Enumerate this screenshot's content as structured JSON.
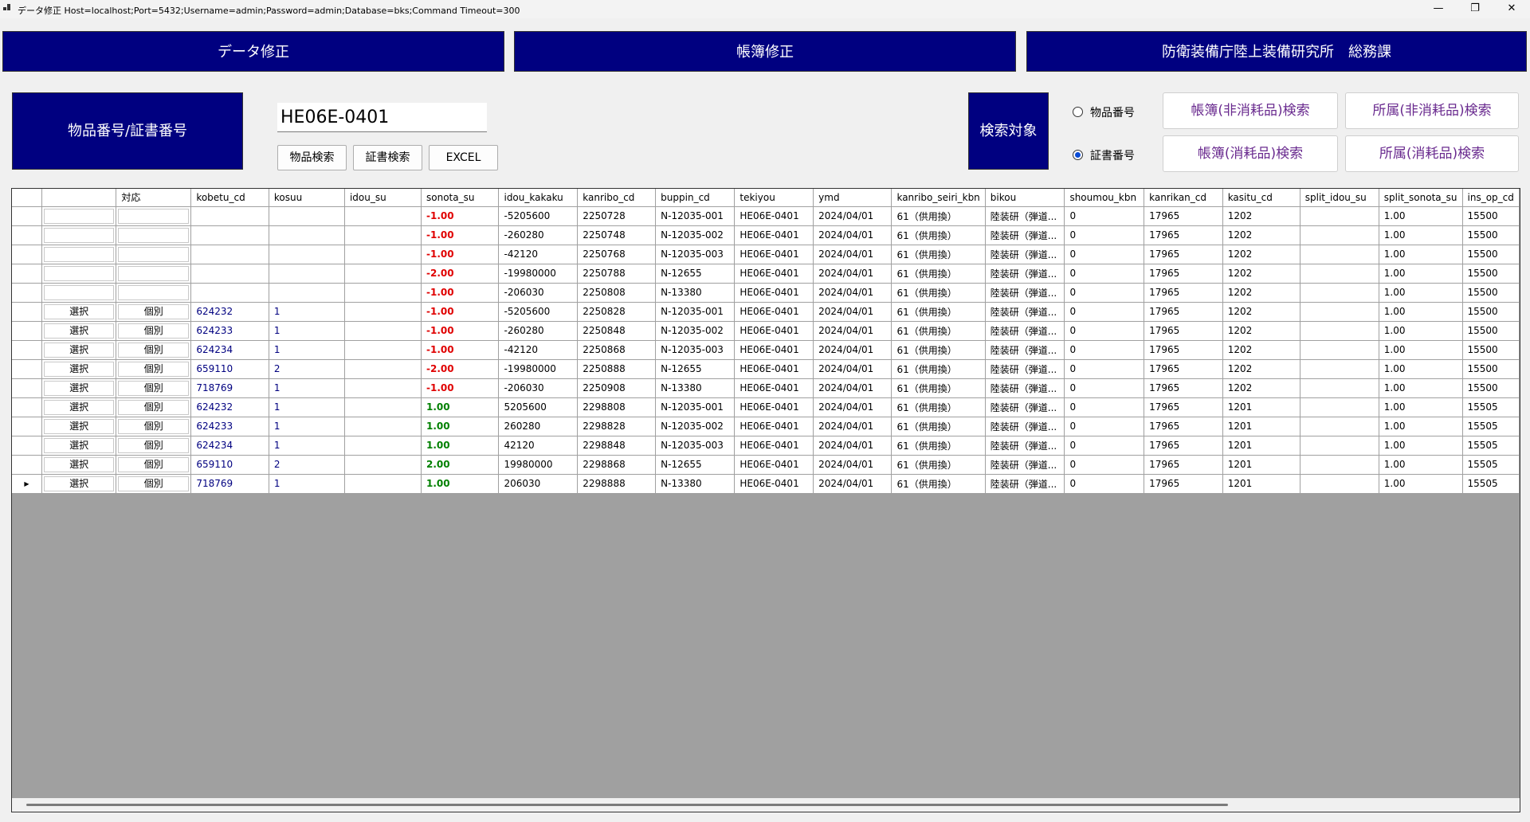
{
  "window": {
    "title": "データ修正 Host=localhost;Port=5432;Username=admin;Password=admin;Database=bks;Command Timeout=300",
    "minimize": "—",
    "restore": "❐",
    "close": "✕"
  },
  "nav": {
    "data_fix": "データ修正",
    "ledger_fix": "帳簿修正",
    "org": "防衛装備庁陸上装備研究所　総務課"
  },
  "search": {
    "label": "物品番号/証書番号",
    "value": "HE06E-0401",
    "item_search": "物品検索",
    "cert_search": "証書検索",
    "excel": "EXCEL",
    "target_label": "検索対象",
    "radio_item": "物品番号",
    "radio_cert": "証書番号",
    "selected_radio": "証書番号",
    "btn_ledger_nonconsumable": "帳簿(非消耗品)検索",
    "btn_dept_nonconsumable": "所属(非消耗品)検索",
    "btn_ledger_consumable": "帳簿(消耗品)検索",
    "btn_dept_consumable": "所属(消耗品)検索"
  },
  "grid": {
    "columns": [
      "",
      "",
      "対応",
      "kobetu_cd",
      "kosuu",
      "idou_su",
      "sonota_su",
      "idou_kakaku",
      "kanribo_cd",
      "buppin_cd",
      "tekiyou",
      "ymd",
      "kanribo_seiri_kbn",
      "bikou",
      "shoumou_kbn",
      "kanrikan_cd",
      "kasitu_cd",
      "split_idou_su",
      "split_sonota_su",
      "ins_op_cd"
    ],
    "current_row_marker": "▶",
    "rows": [
      {
        "sel": "",
        "taiou": "",
        "kobetu_cd": "",
        "kosuu": "",
        "idou_su": "",
        "sonota_su": "-1.00",
        "idou_kakaku": "-5205600",
        "kanribo_cd": "2250728",
        "buppin_cd": "N-12035-001",
        "tekiyou": "HE06E-0401",
        "ymd": "2024/04/01",
        "kanribo_seiri_kbn": "61（供用換）",
        "bikou": "陸装研（弾道...",
        "shoumou_kbn": "0",
        "kanrikan_cd": "17965",
        "kasitu_cd": "1202",
        "split_idou_su": "",
        "split_sonota_su": "1.00",
        "ins_op_cd": "15500"
      },
      {
        "sel": "",
        "taiou": "",
        "kobetu_cd": "",
        "kosuu": "",
        "idou_su": "",
        "sonota_su": "-1.00",
        "idou_kakaku": "-260280",
        "kanribo_cd": "2250748",
        "buppin_cd": "N-12035-002",
        "tekiyou": "HE06E-0401",
        "ymd": "2024/04/01",
        "kanribo_seiri_kbn": "61（供用換）",
        "bikou": "陸装研（弾道...",
        "shoumou_kbn": "0",
        "kanrikan_cd": "17965",
        "kasitu_cd": "1202",
        "split_idou_su": "",
        "split_sonota_su": "1.00",
        "ins_op_cd": "15500"
      },
      {
        "sel": "",
        "taiou": "",
        "kobetu_cd": "",
        "kosuu": "",
        "idou_su": "",
        "sonota_su": "-1.00",
        "idou_kakaku": "-42120",
        "kanribo_cd": "2250768",
        "buppin_cd": "N-12035-003",
        "tekiyou": "HE06E-0401",
        "ymd": "2024/04/01",
        "kanribo_seiri_kbn": "61（供用換）",
        "bikou": "陸装研（弾道...",
        "shoumou_kbn": "0",
        "kanrikan_cd": "17965",
        "kasitu_cd": "1202",
        "split_idou_su": "",
        "split_sonota_su": "1.00",
        "ins_op_cd": "15500"
      },
      {
        "sel": "",
        "taiou": "",
        "kobetu_cd": "",
        "kosuu": "",
        "idou_su": "",
        "sonota_su": "-2.00",
        "idou_kakaku": "-19980000",
        "kanribo_cd": "2250788",
        "buppin_cd": "N-12655",
        "tekiyou": "HE06E-0401",
        "ymd": "2024/04/01",
        "kanribo_seiri_kbn": "61（供用換）",
        "bikou": "陸装研（弾道...",
        "shoumou_kbn": "0",
        "kanrikan_cd": "17965",
        "kasitu_cd": "1202",
        "split_idou_su": "",
        "split_sonota_su": "1.00",
        "ins_op_cd": "15500"
      },
      {
        "sel": "",
        "taiou": "",
        "kobetu_cd": "",
        "kosuu": "",
        "idou_su": "",
        "sonota_su": "-1.00",
        "idou_kakaku": "-206030",
        "kanribo_cd": "2250808",
        "buppin_cd": "N-13380",
        "tekiyou": "HE06E-0401",
        "ymd": "2024/04/01",
        "kanribo_seiri_kbn": "61（供用換）",
        "bikou": "陸装研（弾道...",
        "shoumou_kbn": "0",
        "kanrikan_cd": "17965",
        "kasitu_cd": "1202",
        "split_idou_su": "",
        "split_sonota_su": "1.00",
        "ins_op_cd": "15500"
      },
      {
        "sel": "選択",
        "taiou": "個別",
        "kobetu_cd": "624232",
        "kosuu": "1",
        "idou_su": "",
        "sonota_su": "-1.00",
        "idou_kakaku": "-5205600",
        "kanribo_cd": "2250828",
        "buppin_cd": "N-12035-001",
        "tekiyou": "HE06E-0401",
        "ymd": "2024/04/01",
        "kanribo_seiri_kbn": "61（供用換）",
        "bikou": "陸装研（弾道...",
        "shoumou_kbn": "0",
        "kanrikan_cd": "17965",
        "kasitu_cd": "1202",
        "split_idou_su": "",
        "split_sonota_su": "1.00",
        "ins_op_cd": "15500"
      },
      {
        "sel": "選択",
        "taiou": "個別",
        "kobetu_cd": "624233",
        "kosuu": "1",
        "idou_su": "",
        "sonota_su": "-1.00",
        "idou_kakaku": "-260280",
        "kanribo_cd": "2250848",
        "buppin_cd": "N-12035-002",
        "tekiyou": "HE06E-0401",
        "ymd": "2024/04/01",
        "kanribo_seiri_kbn": "61（供用換）",
        "bikou": "陸装研（弾道...",
        "shoumou_kbn": "0",
        "kanrikan_cd": "17965",
        "kasitu_cd": "1202",
        "split_idou_su": "",
        "split_sonota_su": "1.00",
        "ins_op_cd": "15500"
      },
      {
        "sel": "選択",
        "taiou": "個別",
        "kobetu_cd": "624234",
        "kosuu": "1",
        "idou_su": "",
        "sonota_su": "-1.00",
        "idou_kakaku": "-42120",
        "kanribo_cd": "2250868",
        "buppin_cd": "N-12035-003",
        "tekiyou": "HE06E-0401",
        "ymd": "2024/04/01",
        "kanribo_seiri_kbn": "61（供用換）",
        "bikou": "陸装研（弾道...",
        "shoumou_kbn": "0",
        "kanrikan_cd": "17965",
        "kasitu_cd": "1202",
        "split_idou_su": "",
        "split_sonota_su": "1.00",
        "ins_op_cd": "15500"
      },
      {
        "sel": "選択",
        "taiou": "個別",
        "kobetu_cd": "659110",
        "kosuu": "2",
        "idou_su": "",
        "sonota_su": "-2.00",
        "idou_kakaku": "-19980000",
        "kanribo_cd": "2250888",
        "buppin_cd": "N-12655",
        "tekiyou": "HE06E-0401",
        "ymd": "2024/04/01",
        "kanribo_seiri_kbn": "61（供用換）",
        "bikou": "陸装研（弾道...",
        "shoumou_kbn": "0",
        "kanrikan_cd": "17965",
        "kasitu_cd": "1202",
        "split_idou_su": "",
        "split_sonota_su": "1.00",
        "ins_op_cd": "15500"
      },
      {
        "sel": "選択",
        "taiou": "個別",
        "kobetu_cd": "718769",
        "kosuu": "1",
        "idou_su": "",
        "sonota_su": "-1.00",
        "idou_kakaku": "-206030",
        "kanribo_cd": "2250908",
        "buppin_cd": "N-13380",
        "tekiyou": "HE06E-0401",
        "ymd": "2024/04/01",
        "kanribo_seiri_kbn": "61（供用換）",
        "bikou": "陸装研（弾道...",
        "shoumou_kbn": "0",
        "kanrikan_cd": "17965",
        "kasitu_cd": "1202",
        "split_idou_su": "",
        "split_sonota_su": "1.00",
        "ins_op_cd": "15500"
      },
      {
        "sel": "選択",
        "taiou": "個別",
        "kobetu_cd": "624232",
        "kosuu": "1",
        "idou_su": "",
        "sonota_su": "1.00",
        "idou_kakaku": "5205600",
        "kanribo_cd": "2298808",
        "buppin_cd": "N-12035-001",
        "tekiyou": "HE06E-0401",
        "ymd": "2024/04/01",
        "kanribo_seiri_kbn": "61（供用換）",
        "bikou": "陸装研（弾道...",
        "shoumou_kbn": "0",
        "kanrikan_cd": "17965",
        "kasitu_cd": "1201",
        "split_idou_su": "",
        "split_sonota_su": "1.00",
        "ins_op_cd": "15505"
      },
      {
        "sel": "選択",
        "taiou": "個別",
        "kobetu_cd": "624233",
        "kosuu": "1",
        "idou_su": "",
        "sonota_su": "1.00",
        "idou_kakaku": "260280",
        "kanribo_cd": "2298828",
        "buppin_cd": "N-12035-002",
        "tekiyou": "HE06E-0401",
        "ymd": "2024/04/01",
        "kanribo_seiri_kbn": "61（供用換）",
        "bikou": "陸装研（弾道...",
        "shoumou_kbn": "0",
        "kanrikan_cd": "17965",
        "kasitu_cd": "1201",
        "split_idou_su": "",
        "split_sonota_su": "1.00",
        "ins_op_cd": "15505"
      },
      {
        "sel": "選択",
        "taiou": "個別",
        "kobetu_cd": "624234",
        "kosuu": "1",
        "idou_su": "",
        "sonota_su": "1.00",
        "idou_kakaku": "42120",
        "kanribo_cd": "2298848",
        "buppin_cd": "N-12035-003",
        "tekiyou": "HE06E-0401",
        "ymd": "2024/04/01",
        "kanribo_seiri_kbn": "61（供用換）",
        "bikou": "陸装研（弾道...",
        "shoumou_kbn": "0",
        "kanrikan_cd": "17965",
        "kasitu_cd": "1201",
        "split_idou_su": "",
        "split_sonota_su": "1.00",
        "ins_op_cd": "15505"
      },
      {
        "sel": "選択",
        "taiou": "個別",
        "kobetu_cd": "659110",
        "kosuu": "2",
        "idou_su": "",
        "sonota_su": "2.00",
        "idou_kakaku": "19980000",
        "kanribo_cd": "2298868",
        "buppin_cd": "N-12655",
        "tekiyou": "HE06E-0401",
        "ymd": "2024/04/01",
        "kanribo_seiri_kbn": "61（供用換）",
        "bikou": "陸装研（弾道...",
        "shoumou_kbn": "0",
        "kanrikan_cd": "17965",
        "kasitu_cd": "1201",
        "split_idou_su": "",
        "split_sonota_su": "1.00",
        "ins_op_cd": "15505"
      },
      {
        "sel": "選択",
        "taiou": "個別",
        "kobetu_cd": "718769",
        "kosuu": "1",
        "idou_su": "",
        "sonota_su": "1.00",
        "idou_kakaku": "206030",
        "kanribo_cd": "2298888",
        "buppin_cd": "N-13380",
        "tekiyou": "HE06E-0401",
        "ymd": "2024/04/01",
        "kanribo_seiri_kbn": "61（供用換）",
        "bikou": "陸装研（弾道...",
        "shoumou_kbn": "0",
        "kanrikan_cd": "17965",
        "kasitu_cd": "1201",
        "split_idou_su": "",
        "split_sonota_su": "1.00",
        "ins_op_cd": "15505",
        "current": true
      }
    ]
  },
  "colors": {
    "nav_bg": "#000080",
    "negative": "#e00000",
    "positive": "#008000",
    "link_text": "#000080",
    "button_text": "#6a2b8f",
    "grid_empty": "#a0a0a0"
  }
}
